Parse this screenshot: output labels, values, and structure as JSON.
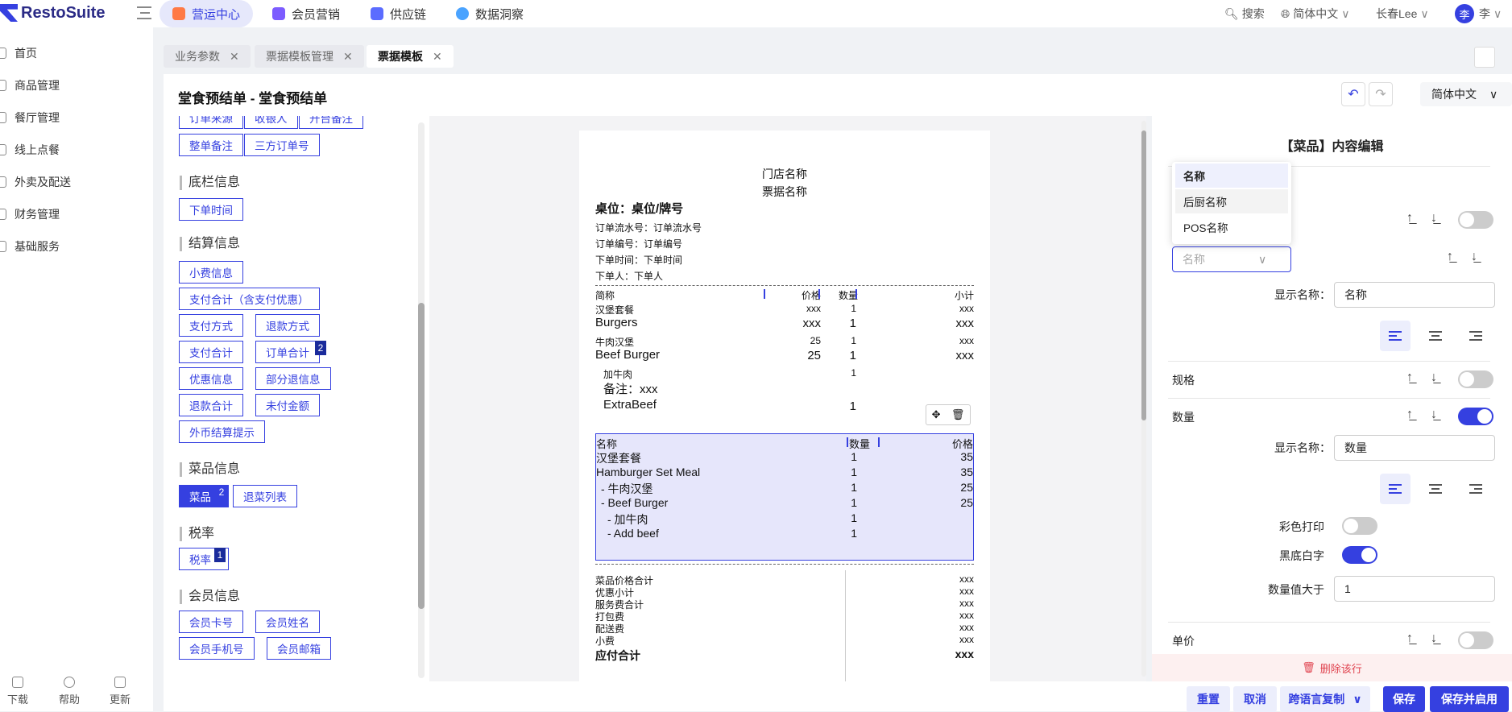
{
  "app": {
    "logo_text": "RestoSuite",
    "colors": {
      "accent": "#3540e0",
      "accent_light": "#e6e8fb",
      "badge": "#1a2b9b"
    }
  },
  "topnav": [
    {
      "label": "营运中心",
      "icon": "operations-icon",
      "active": true
    },
    {
      "label": "会员营销",
      "icon": "member-icon",
      "active": false
    },
    {
      "label": "供应链",
      "icon": "supply-chain-icon",
      "active": false
    },
    {
      "label": "数据洞察",
      "icon": "data-icon",
      "active": false
    }
  ],
  "toolbar": {
    "search_label": "搜索",
    "language_label": "简体中文",
    "store_label": "长春Lee",
    "avatar_text": "李",
    "user_label": "李"
  },
  "sidebar": {
    "items": [
      {
        "label": "首页",
        "icon": "home-icon"
      },
      {
        "label": "商品管理",
        "icon": "product-icon"
      },
      {
        "label": "餐厅管理",
        "icon": "restaurant-icon"
      },
      {
        "label": "线上点餐",
        "icon": "online-order-icon"
      },
      {
        "label": "外卖及配送",
        "icon": "delivery-icon"
      },
      {
        "label": "财务管理",
        "icon": "finance-icon"
      },
      {
        "label": "基础服务",
        "icon": "services-icon"
      }
    ],
    "bottom": [
      {
        "label": "下载",
        "icon": "download-icon"
      },
      {
        "label": "帮助",
        "icon": "help-icon"
      },
      {
        "label": "更新",
        "icon": "update-icon"
      }
    ]
  },
  "tabs": [
    {
      "label": "业务参数",
      "active": false
    },
    {
      "label": "票据模板管理",
      "active": false
    },
    {
      "label": "票据模板",
      "active": true
    }
  ],
  "header": {
    "title": "堂食预结单 - 堂食预结单",
    "language": "简体中文"
  },
  "left_panel": {
    "top_fields": [
      "订单来源",
      "收银人",
      "开台备注",
      "整单备注",
      "三方订单号"
    ],
    "sections": [
      {
        "title": "底栏信息",
        "fields": [
          "下单时间"
        ]
      },
      {
        "title": "结算信息",
        "fields": [
          "小费信息",
          "支付合计（含支付优惠）",
          "支付方式",
          "退款方式",
          "支付合计",
          "订单合计",
          "优惠信息",
          "部分退信息",
          "退款合计",
          "未付金额",
          "外币结算提示"
        ]
      },
      {
        "title": "菜品信息",
        "fields": [
          "菜品",
          "退菜列表"
        ]
      },
      {
        "title": "税率",
        "fields": [
          "税率"
        ]
      },
      {
        "title": "会员信息",
        "fields": [
          "会员卡号",
          "会员姓名",
          "会员手机号",
          "会员邮箱"
        ]
      }
    ],
    "badges": {
      "order_total": "2",
      "dish": "2",
      "tax": "1"
    }
  },
  "receipt": {
    "store_name": "门店名称",
    "receipt_name": "票据名称",
    "table": "桌位：桌位/牌号",
    "info_lines": [
      "订单流水号：订单流水号",
      "订单编号：订单编号",
      "下单时间：下单时间",
      "下单人：下单人"
    ],
    "col_headers": {
      "name": "简称",
      "price": "价格",
      "qty": "数量",
      "subtotal": "小计"
    },
    "items": [
      {
        "name": "汉堡套餐",
        "price": "xxx",
        "qty": "1",
        "subtotal": "xxx",
        "big": false
      },
      {
        "name": "Burgers",
        "price": "xxx",
        "qty": "1",
        "subtotal": "xxx",
        "big": true
      },
      {
        "name": "牛肉汉堡",
        "price": "25",
        "qty": "1",
        "subtotal": "xxx",
        "big": false
      },
      {
        "name": "Beef Burger",
        "price": "25",
        "qty": "1",
        "subtotal": "xxx",
        "big": true
      }
    ],
    "addon_line": {
      "name": "加牛肉",
      "qty": "1"
    },
    "note_line": "备注：xxx",
    "extra_line": {
      "name": "ExtraBeef",
      "qty": "1"
    },
    "selected_block": {
      "headers": {
        "name": "名称",
        "qty": "数量",
        "price": "价格"
      },
      "rows": [
        {
          "name": "汉堡套餐",
          "qty": "1",
          "price": "35"
        },
        {
          "name": "Hamburger Set Meal",
          "qty": "1",
          "price": "35"
        },
        {
          "name": "- 牛肉汉堡",
          "qty": "1",
          "price": "25"
        },
        {
          "name": "- Beef Burger",
          "qty": "1",
          "price": "25"
        },
        {
          "name": "- 加牛肉",
          "qty": "1",
          "price": ""
        },
        {
          "name": "- Add beef",
          "qty": "1",
          "price": ""
        }
      ]
    },
    "totals": [
      {
        "label": "菜品价格合计",
        "value": "xxx"
      },
      {
        "label": "优惠小计",
        "value": "xxx"
      },
      {
        "label": "服务费合计",
        "value": "xxx"
      },
      {
        "label": "打包费",
        "value": "xxx"
      },
      {
        "label": "配送费",
        "value": "xxx"
      },
      {
        "label": "小费",
        "value": "xxx"
      }
    ],
    "grand_total": {
      "label": "应付合计",
      "value": "xxx"
    }
  },
  "right_panel": {
    "title": "【菜品】内容编辑",
    "dropdown_options": [
      "名称",
      "后厨名称",
      "POS名称"
    ],
    "name_select_placeholder": "名称",
    "display_name_label": "显示名称：",
    "name_display_value": "名称",
    "spec_label": "规格",
    "spec_toggle": false,
    "qty_label": "数量",
    "qty_toggle": true,
    "qty_display_value": "数量",
    "color_print_label": "彩色打印",
    "color_print_toggle": false,
    "inverse_label": "黑底白字",
    "inverse_toggle": true,
    "qty_greater_label": "数量值大于",
    "qty_greater_value": "1",
    "unit_price_label": "单价",
    "unit_price_toggle": false,
    "delete_label": "删除该行"
  },
  "bottom_bar": {
    "reset": "重置",
    "cancel": "取消",
    "copy_lang": "跨语言复制",
    "save": "保存",
    "save_enable": "保存并启用"
  }
}
